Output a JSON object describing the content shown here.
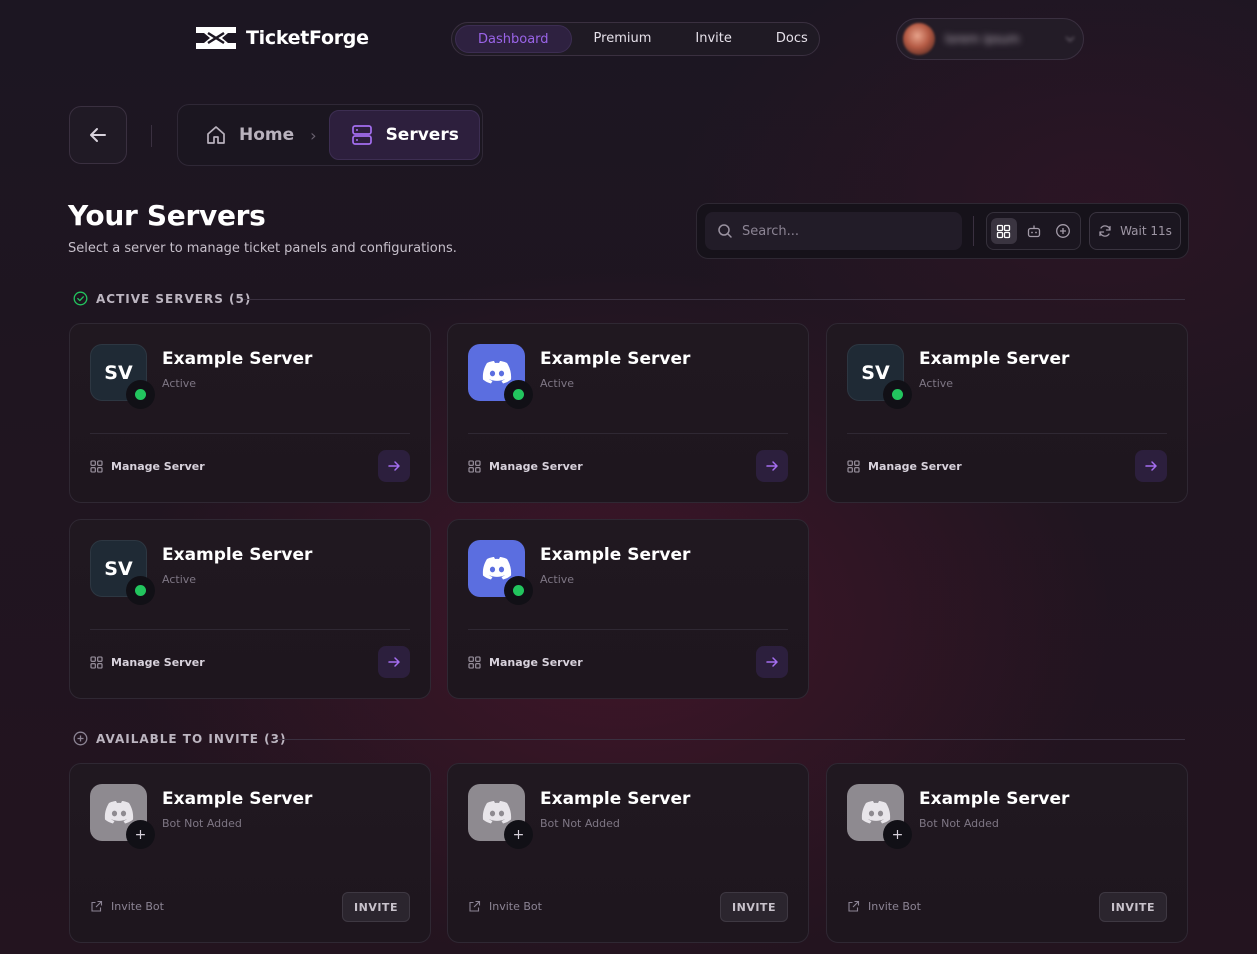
{
  "brand": {
    "name": "TicketForge"
  },
  "nav": {
    "items": [
      {
        "label": "Dashboard",
        "active": true
      },
      {
        "label": "Premium",
        "active": false
      },
      {
        "label": "Invite",
        "active": false
      },
      {
        "label": "Docs",
        "active": false
      }
    ]
  },
  "user": {
    "name": "lorem ipsum"
  },
  "breadcrumb": {
    "home": "Home",
    "current": "Servers"
  },
  "page": {
    "title": "Your Servers",
    "subtitle": "Select a server to manage ticket panels and configurations."
  },
  "toolbar": {
    "search_placeholder": "Search...",
    "wait_label": "Wait 11s"
  },
  "sections": {
    "active": {
      "label": "ACTIVE SERVERS (5)"
    },
    "invite": {
      "label": "AVAILABLE TO INVITE (3)"
    }
  },
  "active_servers": [
    {
      "name": "Example Server",
      "status": "Active",
      "icon": "SV",
      "icon_type": "initials",
      "action": "Manage Server"
    },
    {
      "name": "Example Server",
      "status": "Active",
      "icon": "discord",
      "icon_type": "discord",
      "action": "Manage Server"
    },
    {
      "name": "Example Server",
      "status": "Active",
      "icon": "SV",
      "icon_type": "initials",
      "action": "Manage Server"
    },
    {
      "name": "Example Server",
      "status": "Active",
      "icon": "SV",
      "icon_type": "initials",
      "action": "Manage Server"
    },
    {
      "name": "Example Server",
      "status": "Active",
      "icon": "discord",
      "icon_type": "discord",
      "action": "Manage Server"
    }
  ],
  "invite_servers": [
    {
      "name": "Example Server",
      "status": "Bot Not Added",
      "action": "Invite Bot",
      "button": "INVITE"
    },
    {
      "name": "Example Server",
      "status": "Bot Not Added",
      "action": "Invite Bot",
      "button": "INVITE"
    },
    {
      "name": "Example Server",
      "status": "Bot Not Added",
      "action": "Invite Bot",
      "button": "INVITE"
    }
  ],
  "colors": {
    "accent": "#9a64e8",
    "status_active": "#22c55e",
    "discord": "#5b6ee0"
  }
}
